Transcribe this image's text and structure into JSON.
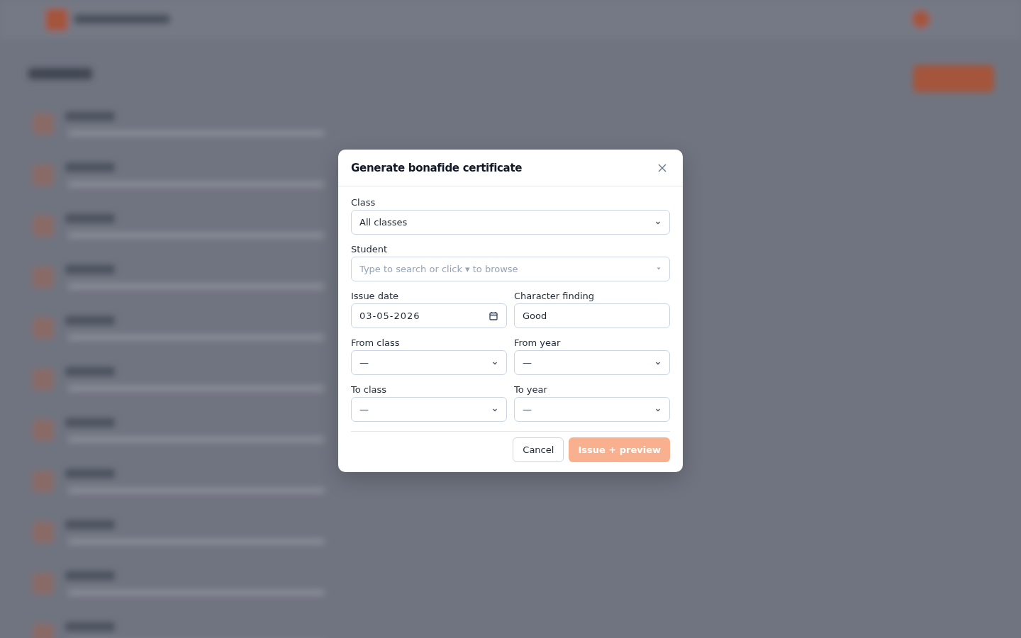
{
  "dialog": {
    "title": "Generate bonafide certificate",
    "rows": [
      [
        {
          "label": "Class",
          "kind": "select",
          "value": "All classes"
        }
      ],
      [
        {
          "label": "Student",
          "kind": "combo",
          "placeholder": "Type to search or click ▾ to browse"
        }
      ],
      [
        {
          "label": "Issue date",
          "kind": "date",
          "value": "03-05-2026"
        },
        {
          "label": "Character finding",
          "kind": "text",
          "value": "Good"
        }
      ],
      [
        {
          "label": "From class",
          "kind": "select",
          "value": "—"
        },
        {
          "label": "From year",
          "kind": "select",
          "value": "—"
        }
      ],
      [
        {
          "label": "To class",
          "kind": "select",
          "value": "—"
        },
        {
          "label": "To year",
          "kind": "select",
          "value": "—"
        }
      ]
    ],
    "buttons": [
      {
        "label": "Cancel",
        "kind": "secondary",
        "disabled": false
      },
      {
        "label": "Issue + preview",
        "kind": "primary",
        "disabled": true
      }
    ]
  }
}
